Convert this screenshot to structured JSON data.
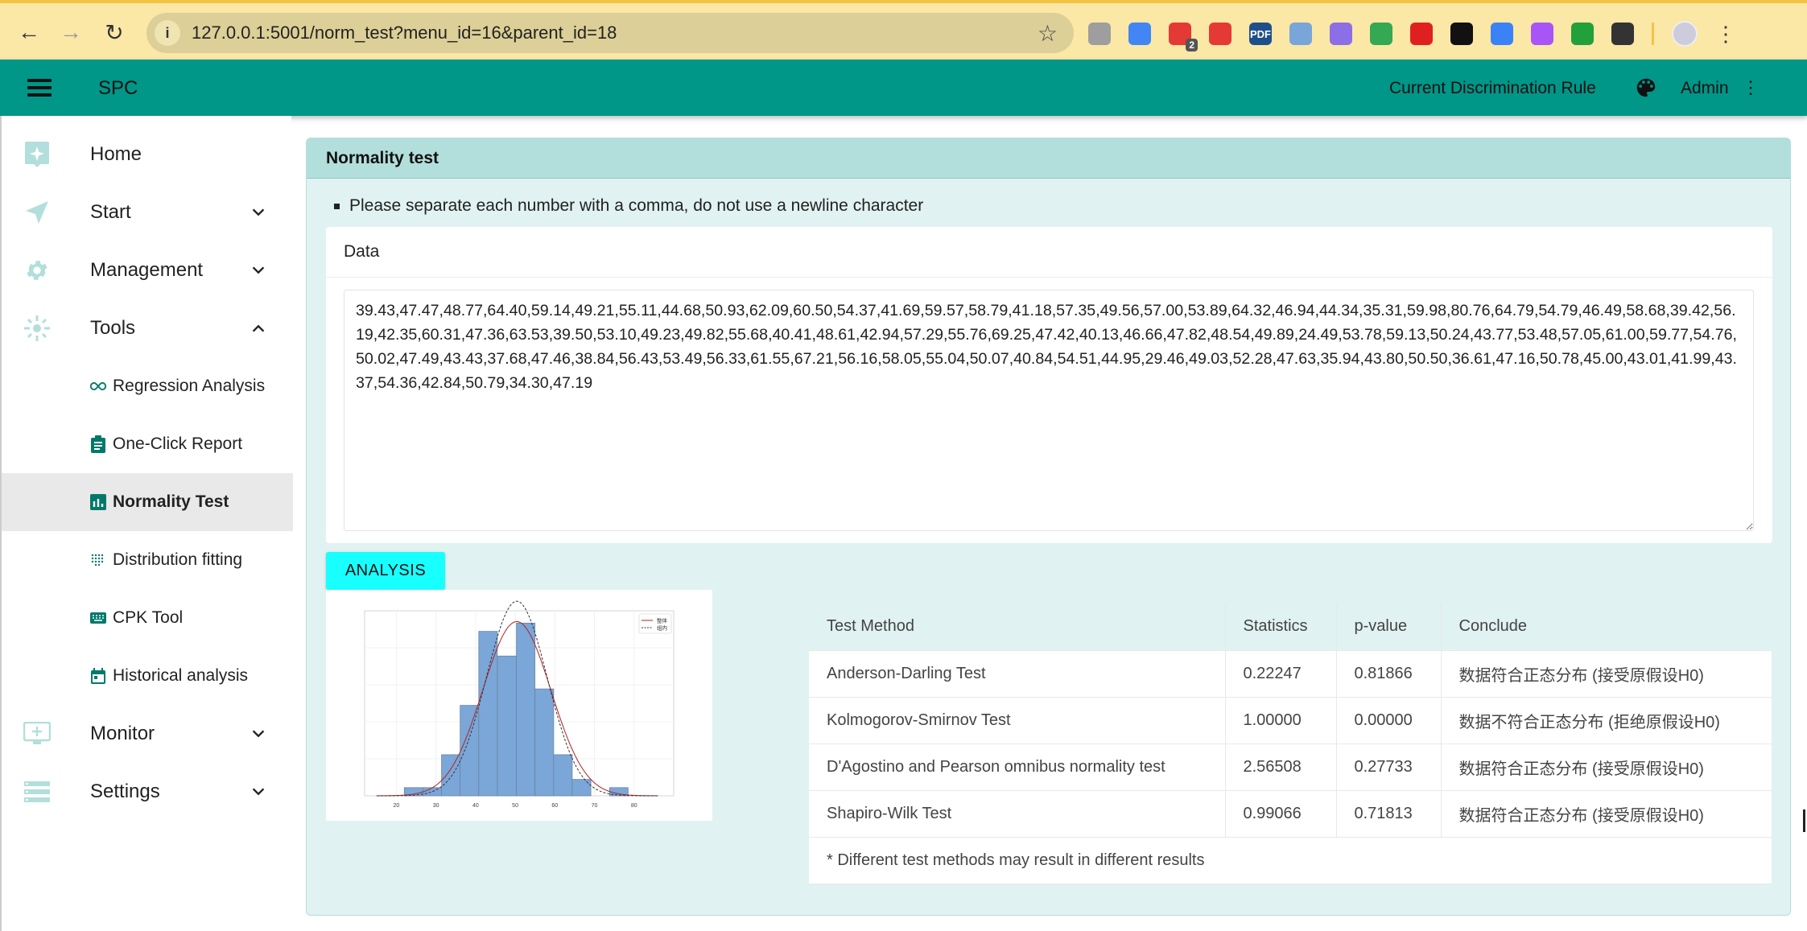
{
  "browser": {
    "url": "127.0.0.1:5001/norm_test?menu_id=16&parent_id=18",
    "extensions": [
      {
        "icon": "circle-extension-icon",
        "color": "#9e9e9e"
      },
      {
        "icon": "google-translate-icon",
        "color": "#4285f4"
      },
      {
        "icon": "dots-extension-icon",
        "color": "#e53935",
        "badge": "2"
      },
      {
        "icon": "no-paw-extension-icon",
        "color": "#e53935"
      },
      {
        "icon": "pdf-extension-icon",
        "color": "#1e4f8a",
        "text": "PDF"
      },
      {
        "icon": "ring-extension-icon",
        "color": "#7aa5d8"
      },
      {
        "icon": "check-extension-icon",
        "color": "#8c6fe6"
      },
      {
        "icon": "code-brackets-extension-icon",
        "color": "#34a853"
      },
      {
        "icon": "adblock-hand-icon",
        "color": "#e02020"
      },
      {
        "icon": "block-circle-icon",
        "color": "#111111"
      },
      {
        "icon": "blue-diamond-extension-icon",
        "color": "#3b82f6"
      },
      {
        "icon": "history-clock-icon",
        "color": "#a855f7"
      },
      {
        "icon": "green-d-extension-icon",
        "color": "#22a03a"
      },
      {
        "icon": "puzzle-extensions-icon",
        "color": "#333333"
      }
    ]
  },
  "header": {
    "brand": "SPC",
    "rule_link": "Current Discrimination Rule",
    "user": "Admin",
    "accent": "#009688"
  },
  "sidebar": {
    "items": [
      {
        "label": "Home",
        "icon": "home-sparkle-icon",
        "has_chevron": false
      },
      {
        "label": "Start",
        "icon": "send-icon",
        "has_chevron": true,
        "expanded": false
      },
      {
        "label": "Management",
        "icon": "gear-icon",
        "has_chevron": true,
        "expanded": false
      },
      {
        "label": "Tools",
        "icon": "sun-tools-icon",
        "has_chevron": true,
        "expanded": true
      },
      {
        "label": "Monitor",
        "icon": "monitor-add-icon",
        "has_chevron": true,
        "expanded": false
      },
      {
        "label": "Settings",
        "icon": "server-list-icon",
        "has_chevron": true,
        "expanded": false
      }
    ],
    "tools_sub": [
      {
        "label": "Regression Analysis",
        "icon": "infinity-icon",
        "active": false
      },
      {
        "label": "One-Click Report",
        "icon": "clipboard-icon",
        "active": false
      },
      {
        "label": "Normality Test",
        "icon": "bar-chart-icon",
        "active": true
      },
      {
        "label": "Distribution fitting",
        "icon": "dot-grid-icon",
        "active": false
      },
      {
        "label": "CPK Tool",
        "icon": "keyboard-icon",
        "active": false
      },
      {
        "label": "Historical analysis",
        "icon": "calendar-icon",
        "active": false
      }
    ]
  },
  "main": {
    "title": "Normality test",
    "hint": "Please separate each number with a comma, do not use a newline character",
    "data_label": "Data",
    "data_value": "39.43,47.47,48.77,64.40,59.14,49.21,55.11,44.68,50.93,62.09,60.50,54.37,41.69,59.57,58.79,41.18,57.35,49.56,57.00,53.89,64.32,46.94,44.34,35.31,59.98,80.76,64.79,54.79,46.49,58.68,39.42,56.19,42.35,60.31,47.36,63.53,39.50,53.10,49.23,49.82,55.68,40.41,48.61,42.94,57.29,55.76,69.25,47.42,40.13,46.66,47.82,48.54,49.89,24.49,53.78,59.13,50.24,43.77,53.48,57.05,61.00,59.77,54.76,50.02,47.49,43.43,37.68,47.46,38.84,56.43,53.49,56.33,61.55,67.21,56.16,58.05,55.04,50.07,40.84,54.51,44.95,29.46,49.03,52.28,47.63,35.94,43.80,50.50,36.61,47.16,50.78,45.00,43.01,41.99,43.37,54.36,42.84,50.79,34.30,47.19",
    "analysis_button": "ANALYSIS",
    "table": {
      "headers": [
        "Test Method",
        "Statistics",
        "p-value",
        "Conclude"
      ],
      "rows": [
        [
          "Anderson-Darling Test",
          "0.22247",
          "0.81866",
          "数据符合正态分布 (接受原假设H0)"
        ],
        [
          "Kolmogorov-Smirnov Test",
          "1.00000",
          "0.00000",
          "数据不符合正态分布 (拒绝原假设H0)"
        ],
        [
          "D'Agostino and Pearson omnibus normality test",
          "2.56508",
          "0.27733",
          "数据符合正态分布 (接受原假设H0)"
        ],
        [
          "Shapiro-Wilk Test",
          "0.99066",
          "0.71813",
          "数据符合正态分布 (接受原假设H0)"
        ]
      ],
      "note": "* Different test methods may result in different results"
    }
  },
  "chart_data": {
    "type": "bar",
    "title": "",
    "xlabel": "",
    "ylabel": "",
    "bin_edges": [
      22.0,
      26.7,
      31.4,
      36.1,
      40.8,
      45.5,
      50.3,
      55.0,
      59.7,
      64.4,
      69.1,
      73.8,
      78.5
    ],
    "counts": [
      1,
      1,
      5,
      11,
      20,
      17,
      21,
      13,
      5,
      2,
      0,
      1
    ],
    "xlim": [
      12,
      90
    ],
    "ylim": [
      0,
      22.5
    ],
    "xticks": [
      "20",
      "30",
      "40",
      "50",
      "60",
      "70",
      "80"
    ],
    "grid": true,
    "legend_position": "top-right",
    "series": [
      {
        "name": "整体",
        "kind": "normal-curve",
        "mean": 50.4,
        "std": 8.6,
        "color": "#b22222",
        "style": "solid"
      },
      {
        "name": "组内",
        "kind": "normal-curve",
        "mean": 50.4,
        "std": 7.7,
        "color": "#333333",
        "style": "dashed"
      }
    ],
    "bar_color": "#7aa6d8"
  }
}
